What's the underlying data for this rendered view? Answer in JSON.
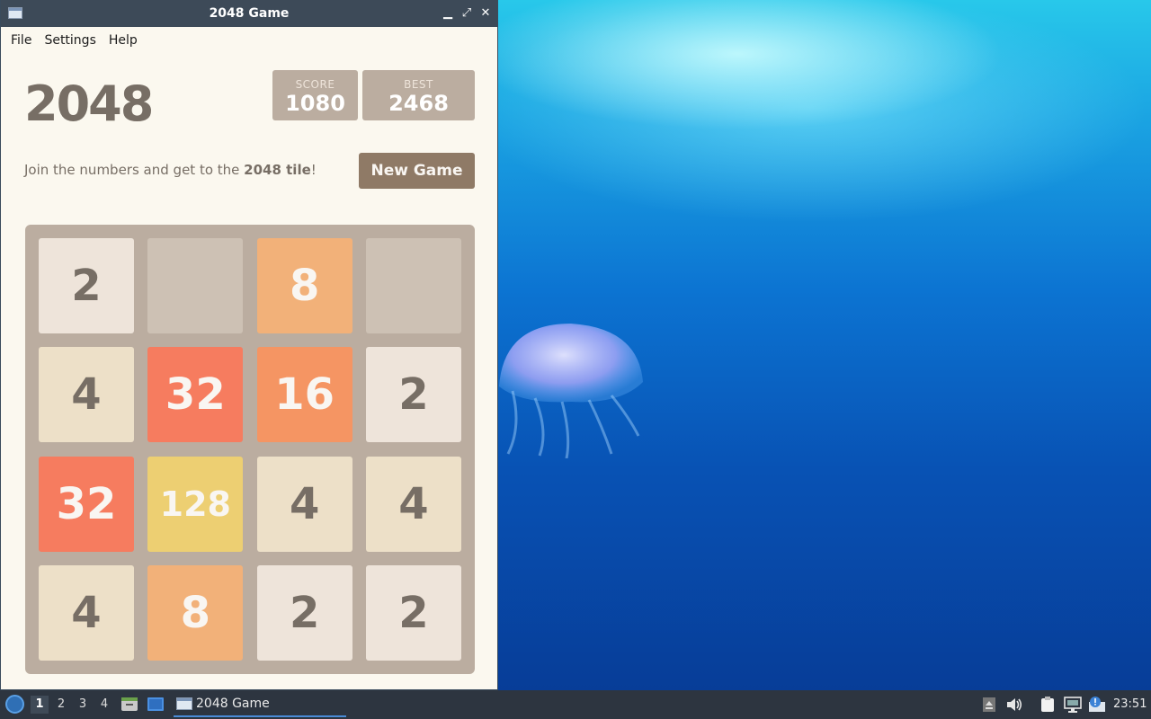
{
  "window": {
    "title": "2048 Game",
    "controls": {
      "minimize": "▁",
      "maximize": "⤢",
      "close": "✕"
    }
  },
  "menu": [
    "File",
    "Settings",
    "Help"
  ],
  "game": {
    "title": "2048",
    "score_label": "SCORE",
    "score": "1080",
    "best_label": "BEST",
    "best": "2468",
    "intro_prefix": "Join the numbers and get to the ",
    "intro_bold": "2048 tile",
    "intro_suffix": "!",
    "new_game": "New Game",
    "grid": [
      [
        "2",
        "",
        "8",
        ""
      ],
      [
        "4",
        "32",
        "16",
        "2"
      ],
      [
        "32",
        "128",
        "4",
        "4"
      ],
      [
        "4",
        "8",
        "2",
        "2"
      ]
    ]
  },
  "taskbar": {
    "workspaces": [
      "1",
      "2",
      "3",
      "4"
    ],
    "active_workspace": "1",
    "task_label": "2048 Game",
    "clock": "23:51"
  },
  "colors": {
    "empty": "#cdc1b4",
    "2": "#eee4da",
    "4": "#ede0c8",
    "8": "#f2b179",
    "16": "#f59563",
    "32": "#f67c5f",
    "128": "#edcf72",
    "dark_text": "#776e65",
    "light_text": "#f9f6f2"
  }
}
